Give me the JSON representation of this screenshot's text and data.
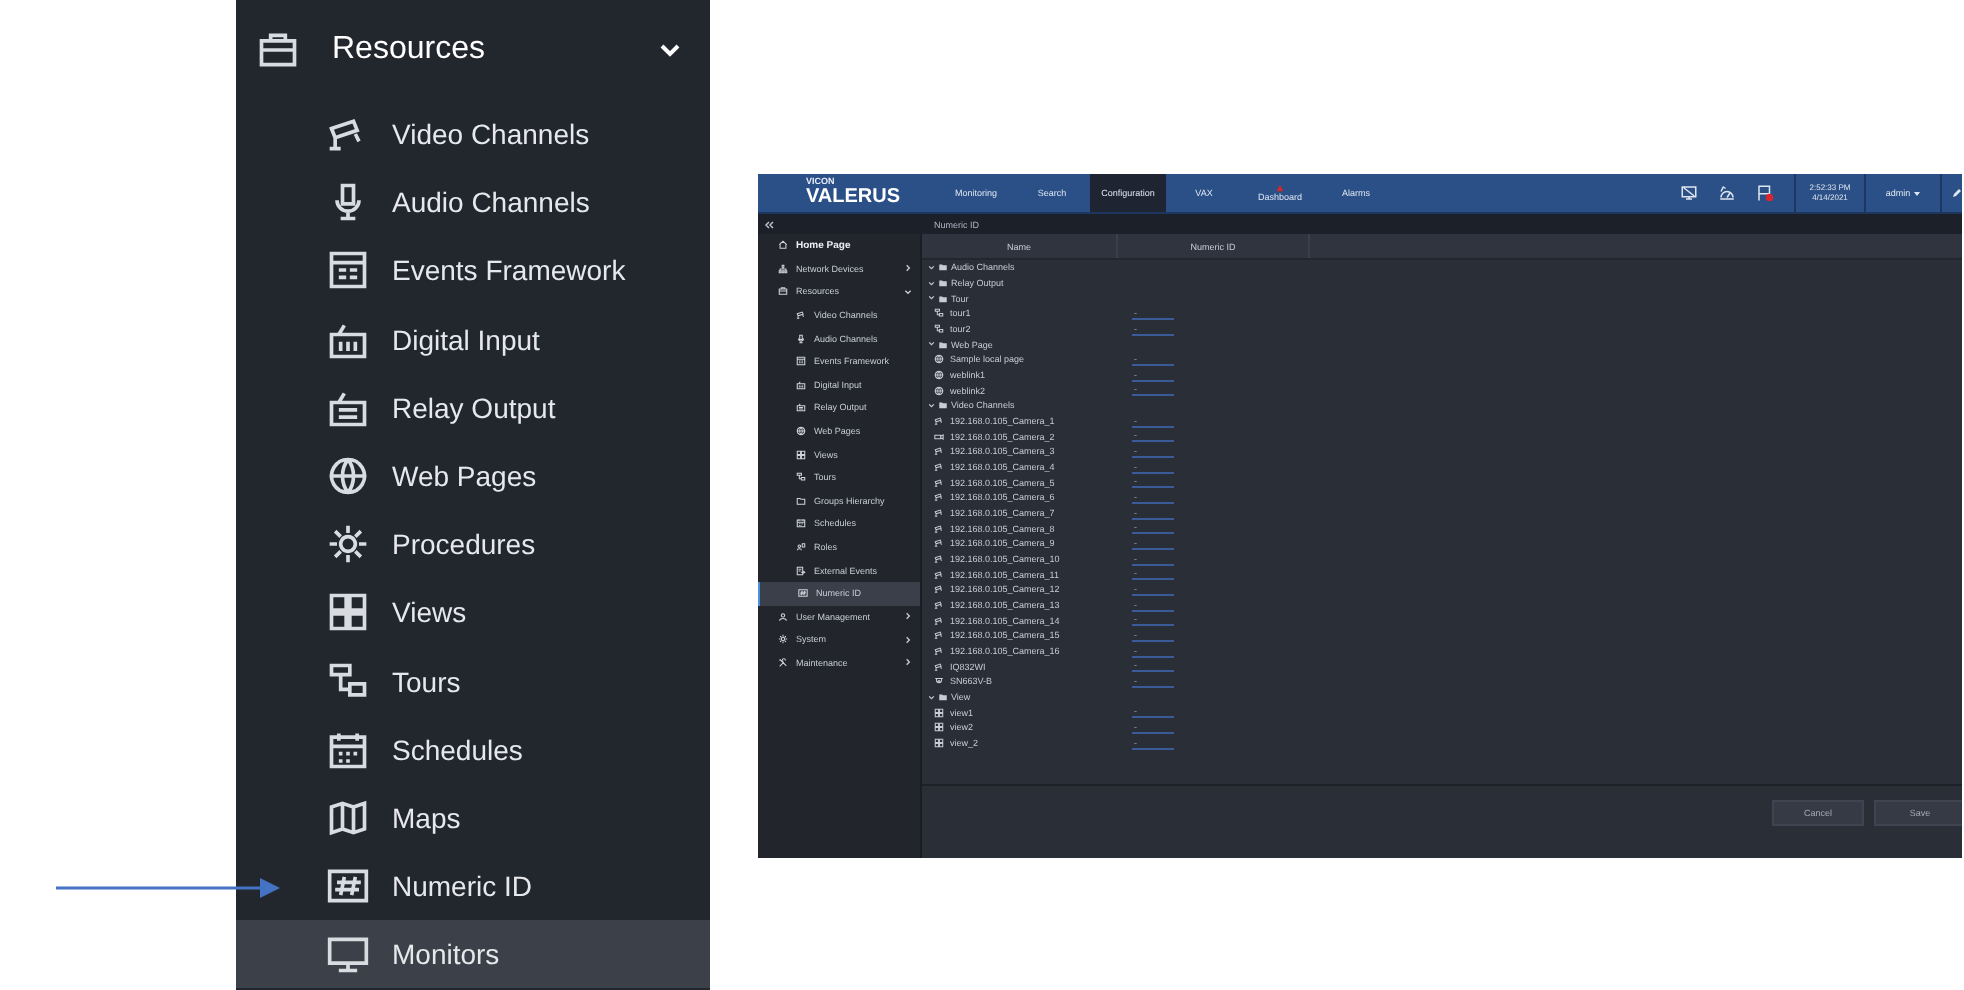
{
  "resources_panel": {
    "header": {
      "label": "Resources",
      "expanded": true
    },
    "items": [
      {
        "label": "Video Channels",
        "selected": false
      },
      {
        "label": "Audio Channels",
        "selected": false
      },
      {
        "label": "Events Framework",
        "selected": false
      },
      {
        "label": "Digital Input",
        "selected": false
      },
      {
        "label": "Relay Output",
        "selected": false
      },
      {
        "label": "Web Pages",
        "selected": false
      },
      {
        "label": "Procedures",
        "selected": false
      },
      {
        "label": "Views",
        "selected": false
      },
      {
        "label": "Tours",
        "selected": false
      },
      {
        "label": "Schedules",
        "selected": false
      },
      {
        "label": "Maps",
        "selected": false
      },
      {
        "label": "Numeric ID",
        "selected": false
      },
      {
        "label": "Monitors",
        "selected": true
      }
    ]
  },
  "screenshot": {
    "logo": {
      "brand": "VICON",
      "product": "VALERUS"
    },
    "nav_tabs": [
      {
        "label": "Monitoring",
        "selected": false,
        "alert": false
      },
      {
        "label": "Search",
        "selected": false,
        "alert": false
      },
      {
        "label": "Configuration",
        "selected": true,
        "alert": false
      },
      {
        "label": "VAX",
        "selected": false,
        "alert": false
      },
      {
        "label": "Dashboard",
        "selected": false,
        "alert": true
      },
      {
        "label": "Alarms",
        "selected": false,
        "alert": false
      }
    ],
    "clock": {
      "time": "2:52:33 PM",
      "date": "4/14/2021"
    },
    "user_menu": "admin",
    "breadcrumb": "Numeric ID",
    "sidebar": [
      {
        "label": "Home Page",
        "kind": "home",
        "selected": false
      },
      {
        "label": "Network Devices",
        "kind": "section",
        "selected": false,
        "expanded": false
      },
      {
        "label": "Resources",
        "kind": "section",
        "selected": false,
        "expanded": true
      },
      {
        "label": "Video Channels",
        "kind": "sub",
        "selected": false
      },
      {
        "label": "Audio Channels",
        "kind": "sub",
        "selected": false
      },
      {
        "label": "Events Framework",
        "kind": "sub",
        "selected": false
      },
      {
        "label": "Digital Input",
        "kind": "sub",
        "selected": false
      },
      {
        "label": "Relay Output",
        "kind": "sub",
        "selected": false
      },
      {
        "label": "Web Pages",
        "kind": "sub",
        "selected": false
      },
      {
        "label": "Views",
        "kind": "sub",
        "selected": false
      },
      {
        "label": "Tours",
        "kind": "sub",
        "selected": false
      },
      {
        "label": "Groups Hierarchy",
        "kind": "sub",
        "selected": false
      },
      {
        "label": "Schedules",
        "kind": "sub",
        "selected": false
      },
      {
        "label": "Roles",
        "kind": "sub",
        "selected": false
      },
      {
        "label": "External Events",
        "kind": "sub",
        "selected": false
      },
      {
        "label": "Numeric ID",
        "kind": "sub",
        "selected": true
      },
      {
        "label": "User Management",
        "kind": "section",
        "selected": false,
        "expanded": false
      },
      {
        "label": "System",
        "kind": "section",
        "selected": false,
        "expanded": false
      },
      {
        "label": "Maintenance",
        "kind": "section",
        "selected": false,
        "expanded": false
      }
    ],
    "table": {
      "columns": [
        "Name",
        "Numeric ID"
      ],
      "groups": [
        {
          "label": "Audio Channels",
          "expanded": true
        },
        {
          "label": "Relay Output",
          "expanded": true
        },
        {
          "label": "Tour",
          "expanded": true,
          "children": [
            {
              "label": "tour1",
              "numeric_id": "-"
            },
            {
              "label": "tour2",
              "numeric_id": "-"
            }
          ]
        },
        {
          "label": "Web Page",
          "expanded": true,
          "children": [
            {
              "label": "Sample local page",
              "numeric_id": "-"
            },
            {
              "label": "weblink1",
              "numeric_id": "-"
            },
            {
              "label": "weblink2",
              "numeric_id": "-"
            }
          ]
        },
        {
          "label": "Video Channels",
          "expanded": true,
          "children": [
            {
              "label": "192.168.0.105_Camera_1",
              "numeric_id": "-"
            },
            {
              "label": "192.168.0.105_Camera_2",
              "numeric_id": "-"
            },
            {
              "label": "192.168.0.105_Camera_3",
              "numeric_id": "-"
            },
            {
              "label": "192.168.0.105_Camera_4",
              "numeric_id": "-"
            },
            {
              "label": "192.168.0.105_Camera_5",
              "numeric_id": "-"
            },
            {
              "label": "192.168.0.105_Camera_6",
              "numeric_id": "-"
            },
            {
              "label": "192.168.0.105_Camera_7",
              "numeric_id": "-"
            },
            {
              "label": "192.168.0.105_Camera_8",
              "numeric_id": "-"
            },
            {
              "label": "192.168.0.105_Camera_9",
              "numeric_id": "-"
            },
            {
              "label": "192.168.0.105_Camera_10",
              "numeric_id": "-"
            },
            {
              "label": "192.168.0.105_Camera_11",
              "numeric_id": "-"
            },
            {
              "label": "192.168.0.105_Camera_12",
              "numeric_id": "-"
            },
            {
              "label": "192.168.0.105_Camera_13",
              "numeric_id": "-"
            },
            {
              "label": "192.168.0.105_Camera_14",
              "numeric_id": "-"
            },
            {
              "label": "192.168.0.105_Camera_15",
              "numeric_id": "-"
            },
            {
              "label": "192.168.0.105_Camera_16",
              "numeric_id": "-"
            },
            {
              "label": "IQ832WI",
              "numeric_id": "-"
            },
            {
              "label": "SN663V-B",
              "numeric_id": "-"
            }
          ]
        },
        {
          "label": "View",
          "expanded": true,
          "children": [
            {
              "label": "view1",
              "numeric_id": "-"
            },
            {
              "label": "view2",
              "numeric_id": "-"
            },
            {
              "label": "view_2",
              "numeric_id": "-"
            }
          ]
        }
      ]
    },
    "buttons": [
      "Cancel",
      "Save"
    ]
  }
}
